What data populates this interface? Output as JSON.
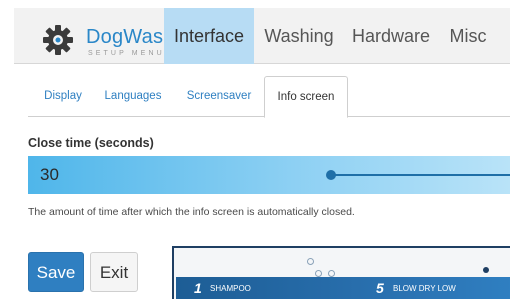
{
  "app": {
    "brand": "DogWash",
    "subtitle": "SETUP MENU",
    "logo_icon": "gear-icon"
  },
  "nav": {
    "tabs": [
      {
        "label": "Interface",
        "active": true
      },
      {
        "label": "Washing",
        "active": false
      },
      {
        "label": "Hardware",
        "active": false
      },
      {
        "label": "Misc",
        "active": false
      }
    ]
  },
  "subnav": {
    "tabs": [
      {
        "label": "Display",
        "active": false
      },
      {
        "label": "Languages",
        "active": false
      },
      {
        "label": "Screensaver",
        "active": false
      },
      {
        "label": "Info screen",
        "active": true
      }
    ]
  },
  "setting": {
    "label": "Close time (seconds)",
    "value": "30",
    "help": "The amount of time after which the info screen is automatically closed."
  },
  "buttons": {
    "save": "Save",
    "exit": "Exit"
  },
  "preview": {
    "steps": [
      {
        "number": "1",
        "label": "SHAMPOO"
      },
      {
        "number": "5",
        "label": "BLOW DRY LOW"
      }
    ]
  },
  "colors": {
    "accent": "#2f7fc1",
    "brand": "#2a87c8",
    "active_tab": "#b7dcf4",
    "slider_fill": "#4fb6ea"
  }
}
